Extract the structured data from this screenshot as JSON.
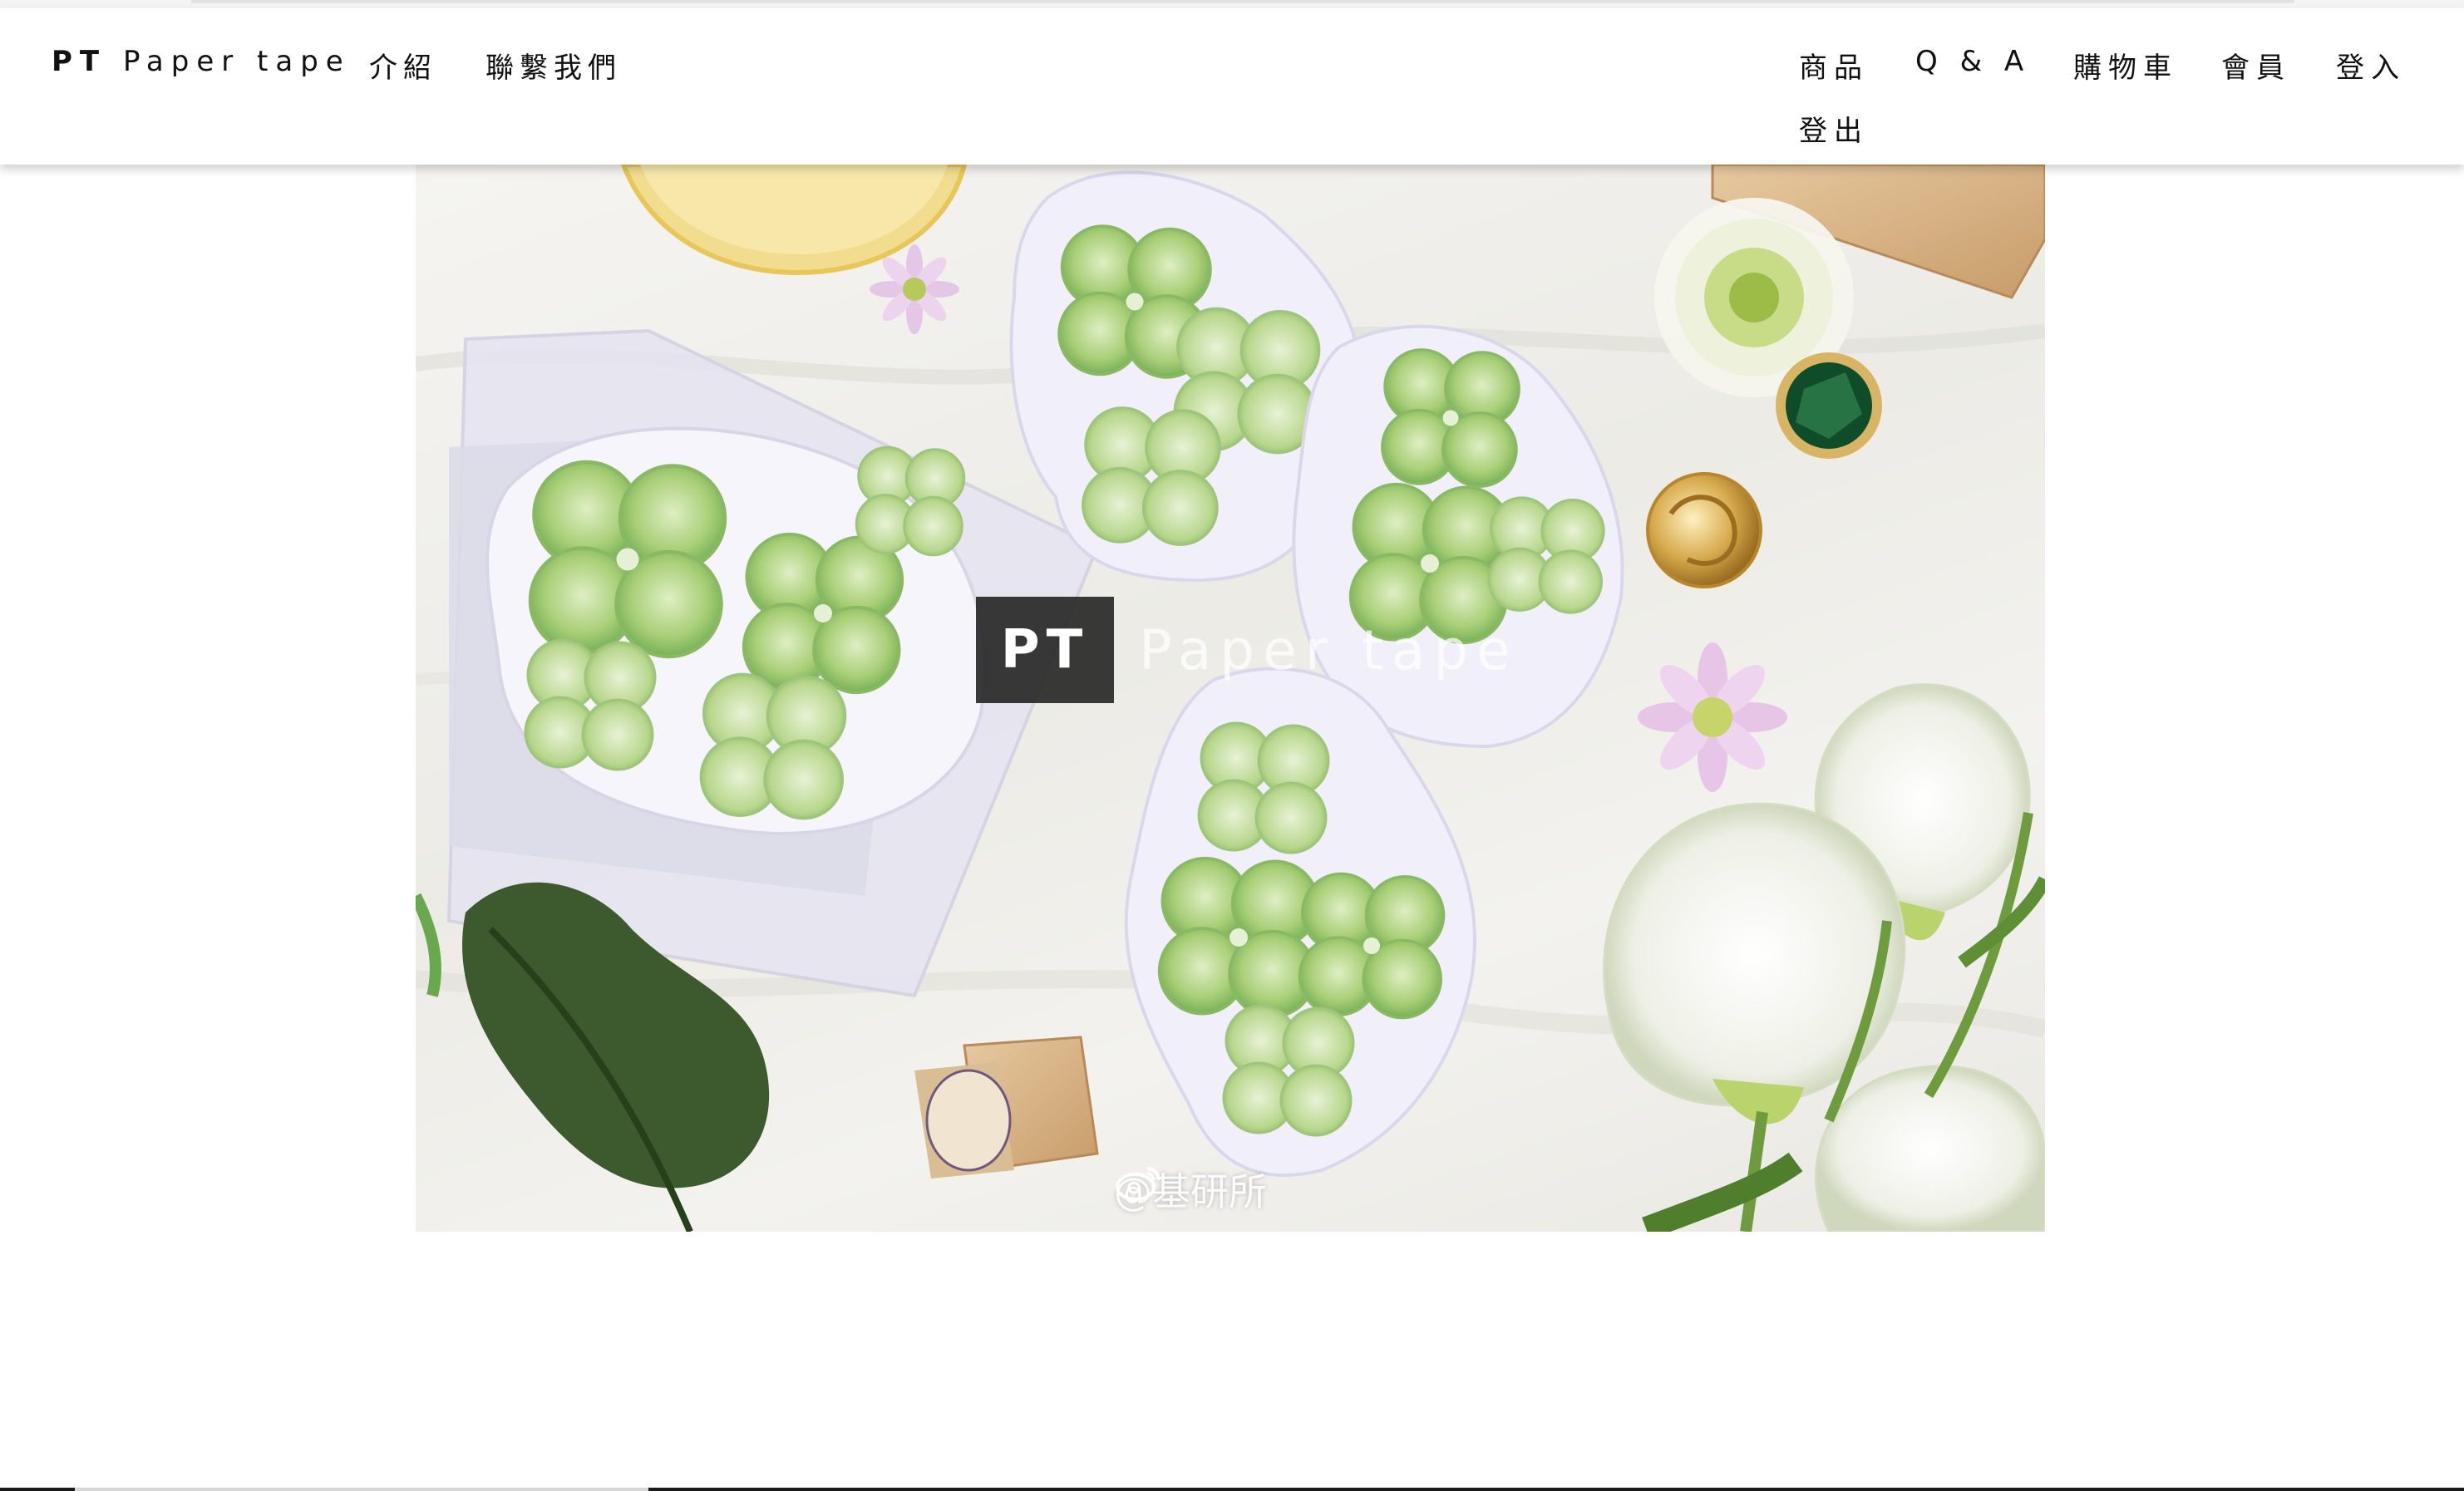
{
  "nav": {
    "brand_bold": "PT",
    "brand_rest": "Paper tape",
    "left_items": [
      "介紹",
      "聯繫我們"
    ],
    "right_items": [
      "商品",
      "Q & A",
      "購物車",
      "會員",
      "登入",
      "登出"
    ]
  },
  "hero": {
    "logo_box": "PT",
    "logo_text": "Paper tape",
    "watermark": "@基研所",
    "watermark_icon": "weibo-icon"
  },
  "colors": {
    "navbar_bg": "#ffffff",
    "logo_box_bg": "#282828",
    "clover_green": "#8fba5a"
  }
}
